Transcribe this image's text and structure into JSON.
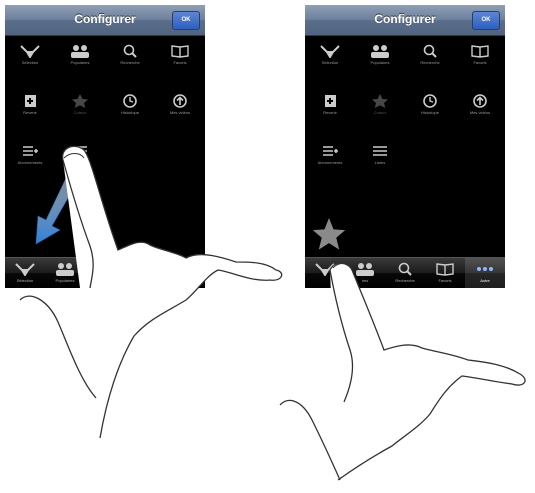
{
  "left": {
    "navbar": {
      "title": "Configurer",
      "ok": "OK"
    },
    "items": [
      {
        "label": "Sélection",
        "icon": "selection-icon"
      },
      {
        "label": "Populaires",
        "icon": "people-icon"
      },
      {
        "label": "Recherche",
        "icon": "search-icon"
      },
      {
        "label": "Favoris",
        "icon": "book-icon"
      },
      {
        "label": "Revenir",
        "icon": "purchased-icon"
      },
      {
        "label": "Coteux",
        "icon": "star-icon"
      },
      {
        "label": "Historique",
        "icon": "clock-icon"
      },
      {
        "label": "Mes vidéos",
        "icon": "arrow-up-icon"
      },
      {
        "label": "Abonnements",
        "icon": "subscriptions-icon"
      },
      {
        "label": "Listes",
        "icon": "list-icon"
      }
    ],
    "tabs": [
      {
        "label": "Sélection",
        "icon": "selection-icon"
      },
      {
        "label": "Populaires",
        "icon": "people-icon"
      },
      {
        "label": "Rech",
        "icon": "search-icon"
      }
    ]
  },
  "right": {
    "navbar": {
      "title": "Configurer",
      "ok": "OK"
    },
    "items": [
      {
        "label": "Sélection",
        "icon": "selection-icon"
      },
      {
        "label": "Populaires",
        "icon": "people-icon"
      },
      {
        "label": "Recherche",
        "icon": "search-icon"
      },
      {
        "label": "Favoris",
        "icon": "book-icon"
      },
      {
        "label": "Revenir",
        "icon": "purchased-icon"
      },
      {
        "label": "Coteux",
        "icon": "star-icon"
      },
      {
        "label": "Historique",
        "icon": "clock-icon"
      },
      {
        "label": "Mes vidéos",
        "icon": "arrow-up-icon"
      },
      {
        "label": "Abonnements",
        "icon": "subscriptions-icon"
      },
      {
        "label": "Listes",
        "icon": "list-icon"
      }
    ],
    "tabs": [
      {
        "label": "",
        "icon": "selection-icon"
      },
      {
        "label": "ires",
        "icon": "people-icon"
      },
      {
        "label": "Recherche",
        "icon": "search-icon"
      },
      {
        "label": "Favoris",
        "icon": "book-icon"
      },
      {
        "label": "Autre",
        "icon": "more-icon"
      }
    ]
  },
  "colors": {
    "accent_arrow": "#2f7fd8",
    "navbar": "#6c7f9b",
    "ok_button": "#3a6bc8"
  }
}
